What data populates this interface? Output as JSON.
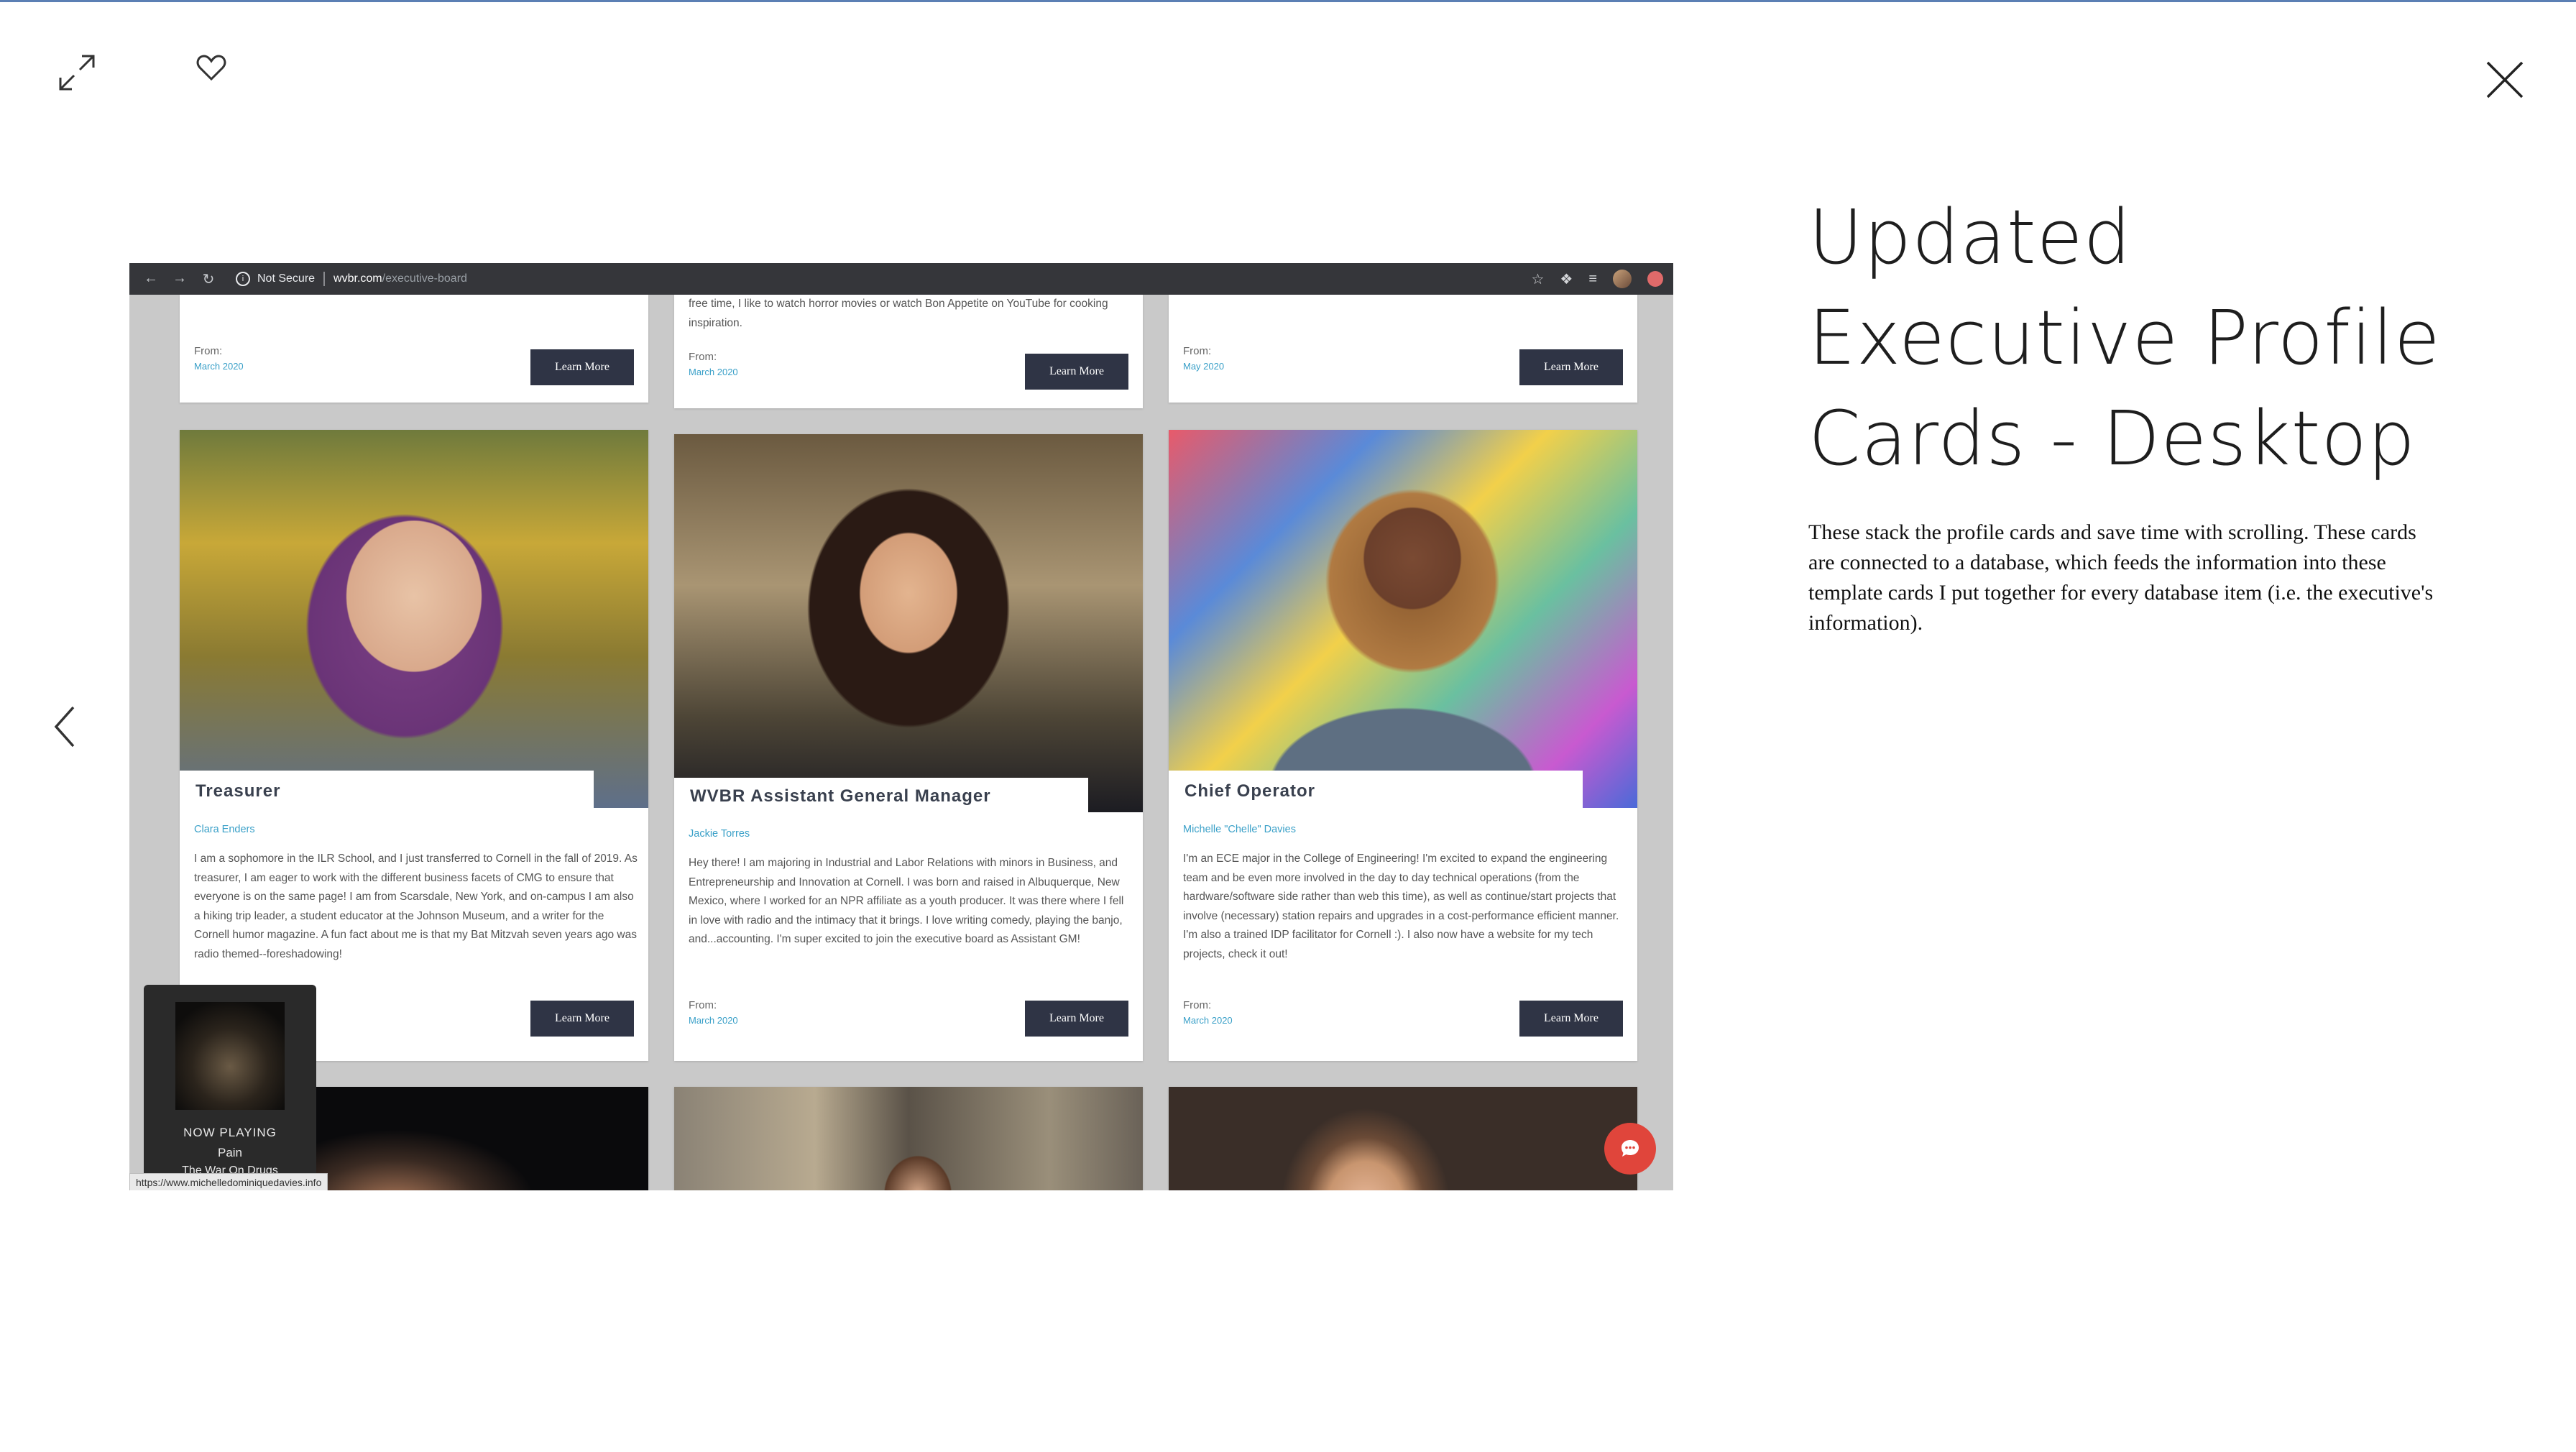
{
  "colors": {
    "accent_blue": "#3aa0c8",
    "button_dark": "#2f3445",
    "chat_red": "#e0453b",
    "browser_bar": "#35363a",
    "page_bg": "#ffffff"
  },
  "viewer": {
    "expand_icon": "expand-arrows-icon",
    "like_icon": "heart-icon",
    "close_icon": "close-x-icon",
    "prev_icon": "chevron-left-icon"
  },
  "project": {
    "title_line1": "Updated",
    "title_line2": "Executive Profile",
    "title_line3": "Cards - Desktop",
    "description": "These stack the profile cards and save time with scrolling. These cards are connected to a database, which feeds the information into these template cards I put together for every database item (i.e. the executive's information)."
  },
  "browser": {
    "security_label": "Not Secure",
    "host": "wvbr.com",
    "path": "/executive-board"
  },
  "top_cards": [
    {
      "text": "",
      "from_label": "From:",
      "from_date": "March 2020",
      "button": "Learn More"
    },
    {
      "text": "free time, I like to watch horror movies or watch Bon Appetite on YouTube for cooking inspiration.",
      "from_label": "From:",
      "from_date": "March 2020",
      "button": "Learn More"
    },
    {
      "text": "",
      "from_label": "From:",
      "from_date": "May 2020",
      "button": "Learn More"
    }
  ],
  "profiles": [
    {
      "role": "Treasurer",
      "name": "Clara Enders",
      "bio": "I am a sophomore in the ILR School, and I just transferred to Cornell in the fall of 2019. As treasurer, I am eager to work with the different business facets of CMG to ensure that everyone is on the same page! I am from Scarsdale, New York, and on-campus I am also a hiking trip leader, a student educator at the Johnson Museum, and a writer for the Cornell humor magazine. A fun fact about me is that my Bat Mitzvah seven years ago was radio themed--foreshadowing!",
      "from_label": "",
      "from_date": "",
      "button": "Learn More"
    },
    {
      "role": "WVBR Assistant General Manager",
      "name": "Jackie Torres",
      "bio": "Hey there! I am majoring in Industrial and Labor Relations with minors in Business, and Entrepreneurship and Innovation at Cornell. I was born and raised in Albuquerque, New Mexico, where I worked for an NPR affiliate as a youth producer. It was there where I fell in love with radio and the intimacy that it brings. I love writing comedy, playing the banjo, and...accounting. I'm super excited to join the executive board as Assistant GM!",
      "from_label": "From:",
      "from_date": "March 2020",
      "button": "Learn More"
    },
    {
      "role": "Chief Operator",
      "name": "Michelle \"Chelle\" Davies",
      "bio": "I'm an ECE major in the College of Engineering! I'm excited to expand the engineering team and be even more involved in the day to day technical operations (from the hardware/software side rather than web this time), as well as continue/start projects that involve (necessary) station repairs and upgrades in a cost-performance efficient manner. I'm also a trained IDP facilitator for Cornell :). I also now have a website for my tech projects, check it out!",
      "from_label": "From:",
      "from_date": "March 2020",
      "button": "Learn More"
    }
  ],
  "now_playing": {
    "label": "NOW PLAYING",
    "track": "Pain",
    "artist": "The War On Drugs"
  },
  "status_url": "https://www.michelledominiquedavies.info"
}
